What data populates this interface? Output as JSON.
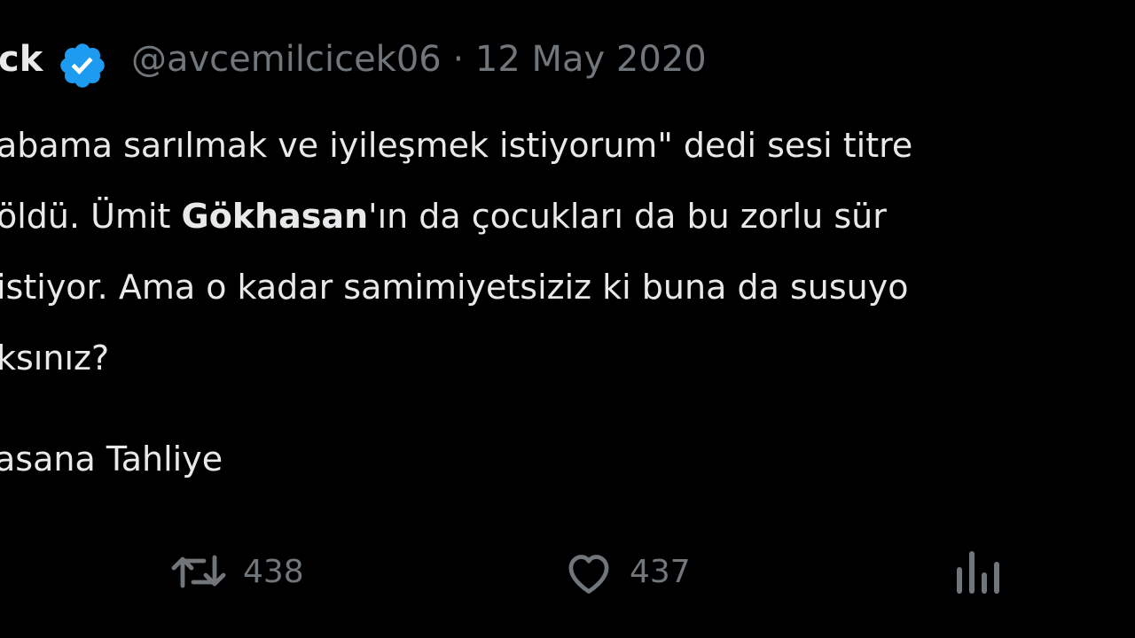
{
  "tweet": {
    "author_name_fragment": "ck",
    "handle": "@avcemilcicek06",
    "separator": "·",
    "date": "12 May 2020",
    "lines": {
      "l1": "abama sarılmak ve iyileşmek istiyorum\" dedi sesi titre",
      "l2_a": "öldü. Ümit ",
      "l2_mention": "Gökhasan",
      "l2_b": "'ın da çocukları da bu zorlu sür",
      "l3": "istiyor. Ama o kadar samimiyetsiziz ki buna da susuyo",
      "l4": "ksınız?"
    },
    "hashtag_line": "asana Tahliye",
    "actions": {
      "retweet_icon": "retweet-icon",
      "retweet_count": "438",
      "like_icon": "heart-icon",
      "like_count": "437",
      "analytics_icon": "analytics-icon"
    }
  },
  "colors": {
    "background": "#000000",
    "text": "#e7e9ea",
    "secondary": "#71767b",
    "verified": "#1d9bf0"
  }
}
